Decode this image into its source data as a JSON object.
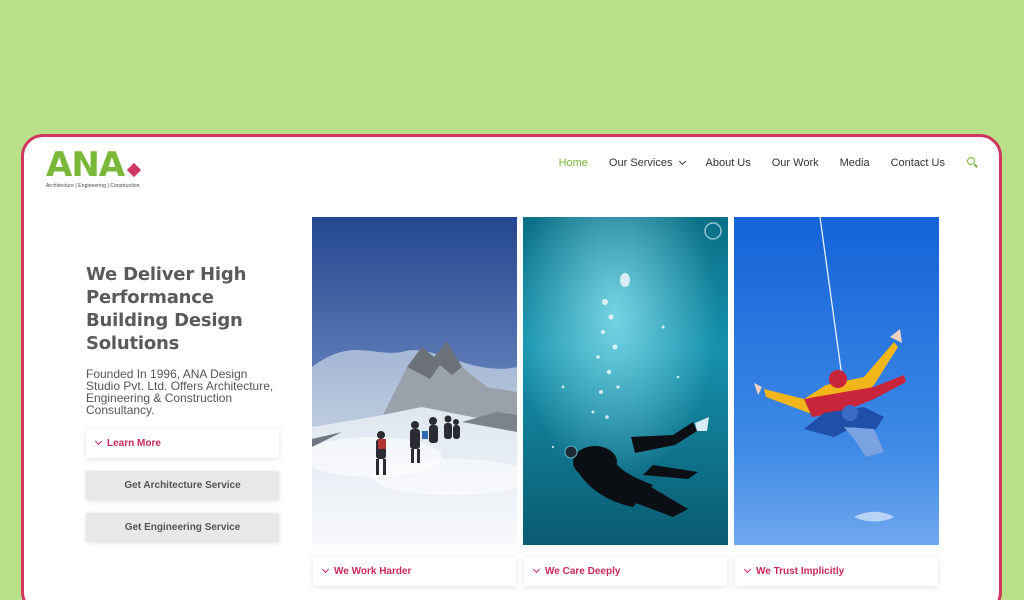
{
  "brand": {
    "logo_text": "ANA",
    "tagline": "Architecture | Engineering | Construction",
    "accent_color": "#d0365f",
    "brand_color": "#7ab83a"
  },
  "nav": {
    "items": [
      {
        "label": "Home",
        "active": true
      },
      {
        "label": "Our Services",
        "has_dropdown": true
      },
      {
        "label": "About Us"
      },
      {
        "label": "Our Work"
      },
      {
        "label": "Media"
      },
      {
        "label": "Contact Us"
      }
    ],
    "search_icon": "search-icon"
  },
  "hero": {
    "headline": "We Deliver High Performance Building Design Solutions",
    "intro": "Founded In 1996, ANA Design Studio Pvt. Ltd. Offers Architecture, Engineering & Construction Consultancy.",
    "learn_more": "Learn More",
    "architecture_button": "Get Architecture Service",
    "engineering_button": "Get Engineering Service"
  },
  "cards": [
    {
      "label": "We Work Harder",
      "image": "mountain-climbers"
    },
    {
      "label": "We Care Deeply",
      "image": "scuba-diver"
    },
    {
      "label": "We Trust Implicitly",
      "image": "tandem-skydivers"
    }
  ]
}
